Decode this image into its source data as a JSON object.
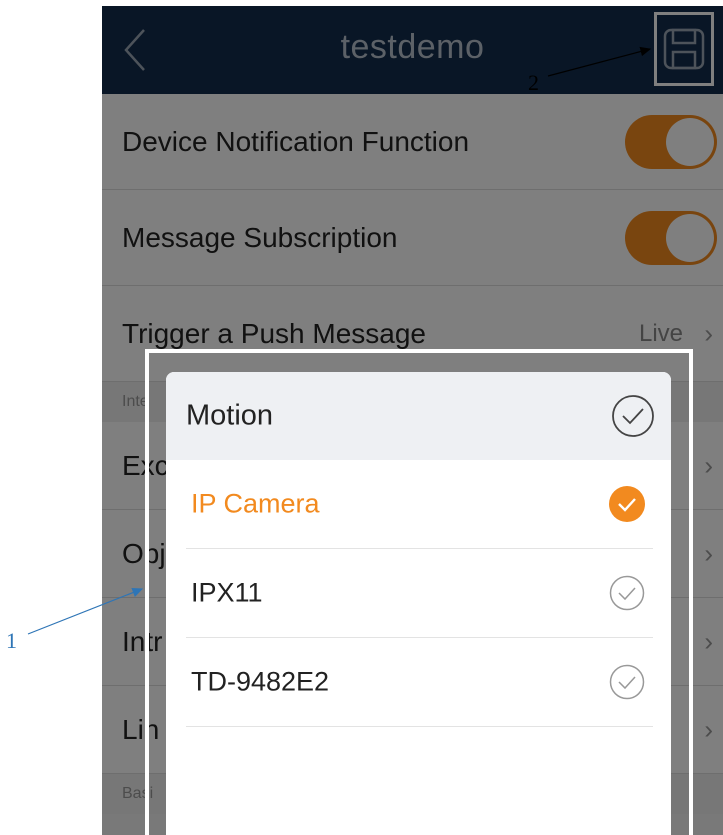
{
  "navbar": {
    "title": "testdemo",
    "back_icon": "chevron-left-icon",
    "save_icon": "floppy-disk-icon"
  },
  "settings": {
    "rows": [
      {
        "label": "Device Notification Function",
        "type": "toggle",
        "on": true
      },
      {
        "label": "Message Subscription",
        "type": "toggle",
        "on": true
      },
      {
        "label": "Trigger a Push Message",
        "value": "Live",
        "type": "link"
      }
    ],
    "section_header": "Inte",
    "hidden_rows": [
      {
        "label": "Exc"
      },
      {
        "label": "Obj"
      },
      {
        "label": "Intr"
      },
      {
        "label": "Lin"
      }
    ],
    "section_header_2": "Basi"
  },
  "dialog": {
    "title": "Motion",
    "options": [
      {
        "label": "IP Camera",
        "selected": true
      },
      {
        "label": "IPX11",
        "selected": false
      },
      {
        "label": "TD-9482E2",
        "selected": false
      }
    ]
  },
  "annotations": {
    "label_1": "1",
    "label_2": "2"
  },
  "colors": {
    "accent": "#f28a1f",
    "navbar": "#132d4c",
    "annotation_line": "#2e75b6"
  }
}
